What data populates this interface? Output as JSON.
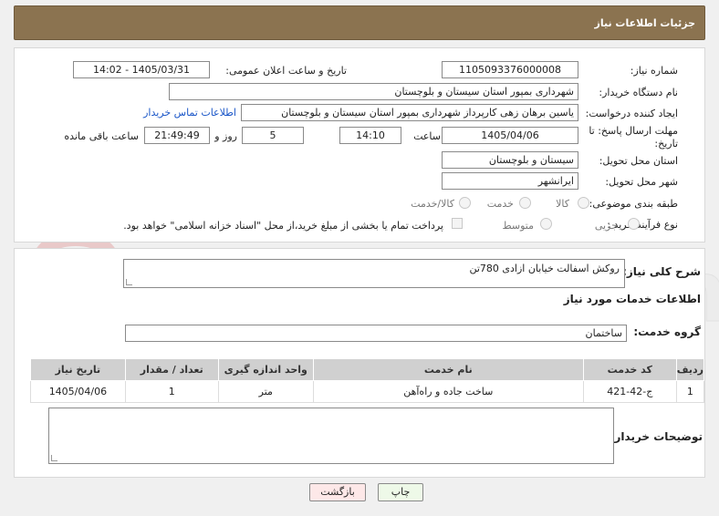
{
  "header": {
    "title": "جزئیات اطلاعات نیاز"
  },
  "form": {
    "need_number": {
      "label": "شماره نیاز:",
      "value": "1105093376000008"
    },
    "announce": {
      "label": "تاریخ و ساعت اعلان عمومی:",
      "value": "1405/03/31 - 14:02"
    },
    "buyer_org": {
      "label": "نام دستگاه خریدار:",
      "value": "شهرداری بمپور استان سیستان و بلوچستان"
    },
    "creator": {
      "label": "ایجاد کننده درخواست:",
      "value": "یاسین برهان زهی کارپرداز شهرداری بمپور استان سیستان و بلوچستان",
      "contact_link": "اطلاعات تماس خریدار"
    },
    "deadline": {
      "label_line1": "مهلت ارسال پاسخ: تا",
      "label_line2": "تاریخ:",
      "date": "1405/04/06",
      "time_label": "ساعت",
      "time": "14:10",
      "days": "5",
      "days_label": "روز و",
      "remaining": "21:49:49",
      "remaining_label": "ساعت باقی مانده"
    },
    "province": {
      "label": "استان محل تحویل:",
      "value": "سیستان و بلوچستان"
    },
    "city": {
      "label": "شهر محل تحویل:",
      "value": "ایرانشهر"
    },
    "category": {
      "label": "طبقه بندی موضوعی:",
      "options": [
        "کالا",
        "خدمت",
        "کالا/خدمت"
      ]
    },
    "process": {
      "label": "نوع فرآیند خرید :",
      "options": [
        "جزیی",
        "متوسط"
      ],
      "note": "پرداخت تمام یا بخشی از مبلغ خرید،از محل \"اسناد خزانه اسلامی\" خواهد بود."
    }
  },
  "description": {
    "label": "شرح کلی نیاز:",
    "value": "روکش اسفالت خیابان ازادی 780تن"
  },
  "services_title": "اطلاعات خدمات مورد نیاز",
  "service_group": {
    "label": "گروه خدمت:",
    "value": "ساختمان"
  },
  "table": {
    "headers": [
      "ردیف",
      "کد خدمت",
      "نام خدمت",
      "واحد اندازه گیری",
      "تعداد / مقدار",
      "تاریخ نیاز"
    ],
    "rows": [
      [
        "1",
        "ج-42-421",
        "ساخت جاده و راه‌آهن",
        "متر",
        "1",
        "1405/04/06"
      ]
    ]
  },
  "buyer_notes": {
    "label": "توضیحات خریدار:",
    "value": ""
  },
  "buttons": {
    "print": "چاپ",
    "back": "بازگشت"
  },
  "watermark_text": "AriaTender.neT",
  "colors": {
    "header_bg": "#8b7350",
    "link": "#1a56c8",
    "back_button": "#fde8e8",
    "print_button": "#eef9e8"
  }
}
